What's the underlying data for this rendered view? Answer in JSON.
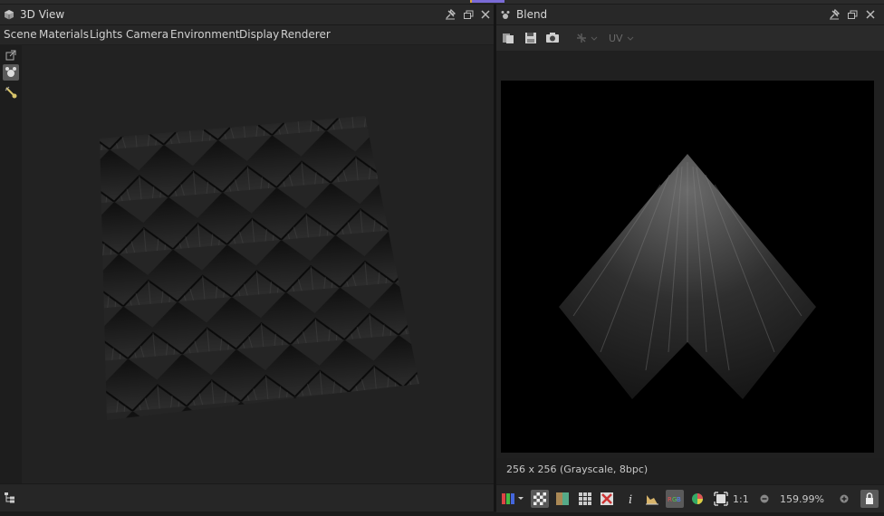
{
  "left_panel": {
    "title": "3D View",
    "menu": [
      "Scene",
      "Materials",
      "Lights",
      "Camera",
      "Environment",
      "Display",
      "Renderer"
    ]
  },
  "right_panel": {
    "title": "Blend",
    "uv_label": "UV",
    "image_info": "256 x 256 (Grayscale, 8bpc)",
    "ratio_label": "1:1",
    "zoom_value": "159.99%"
  },
  "icons": {
    "cube": "cube-icon",
    "pin": "pin-icon",
    "restore": "restore-window-icon",
    "close": "close-icon",
    "paw": "paw-icon"
  },
  "colors": {
    "accent": "#7a6bd6",
    "accent2": "#d8a53a",
    "panel": "#1e1e1e"
  }
}
